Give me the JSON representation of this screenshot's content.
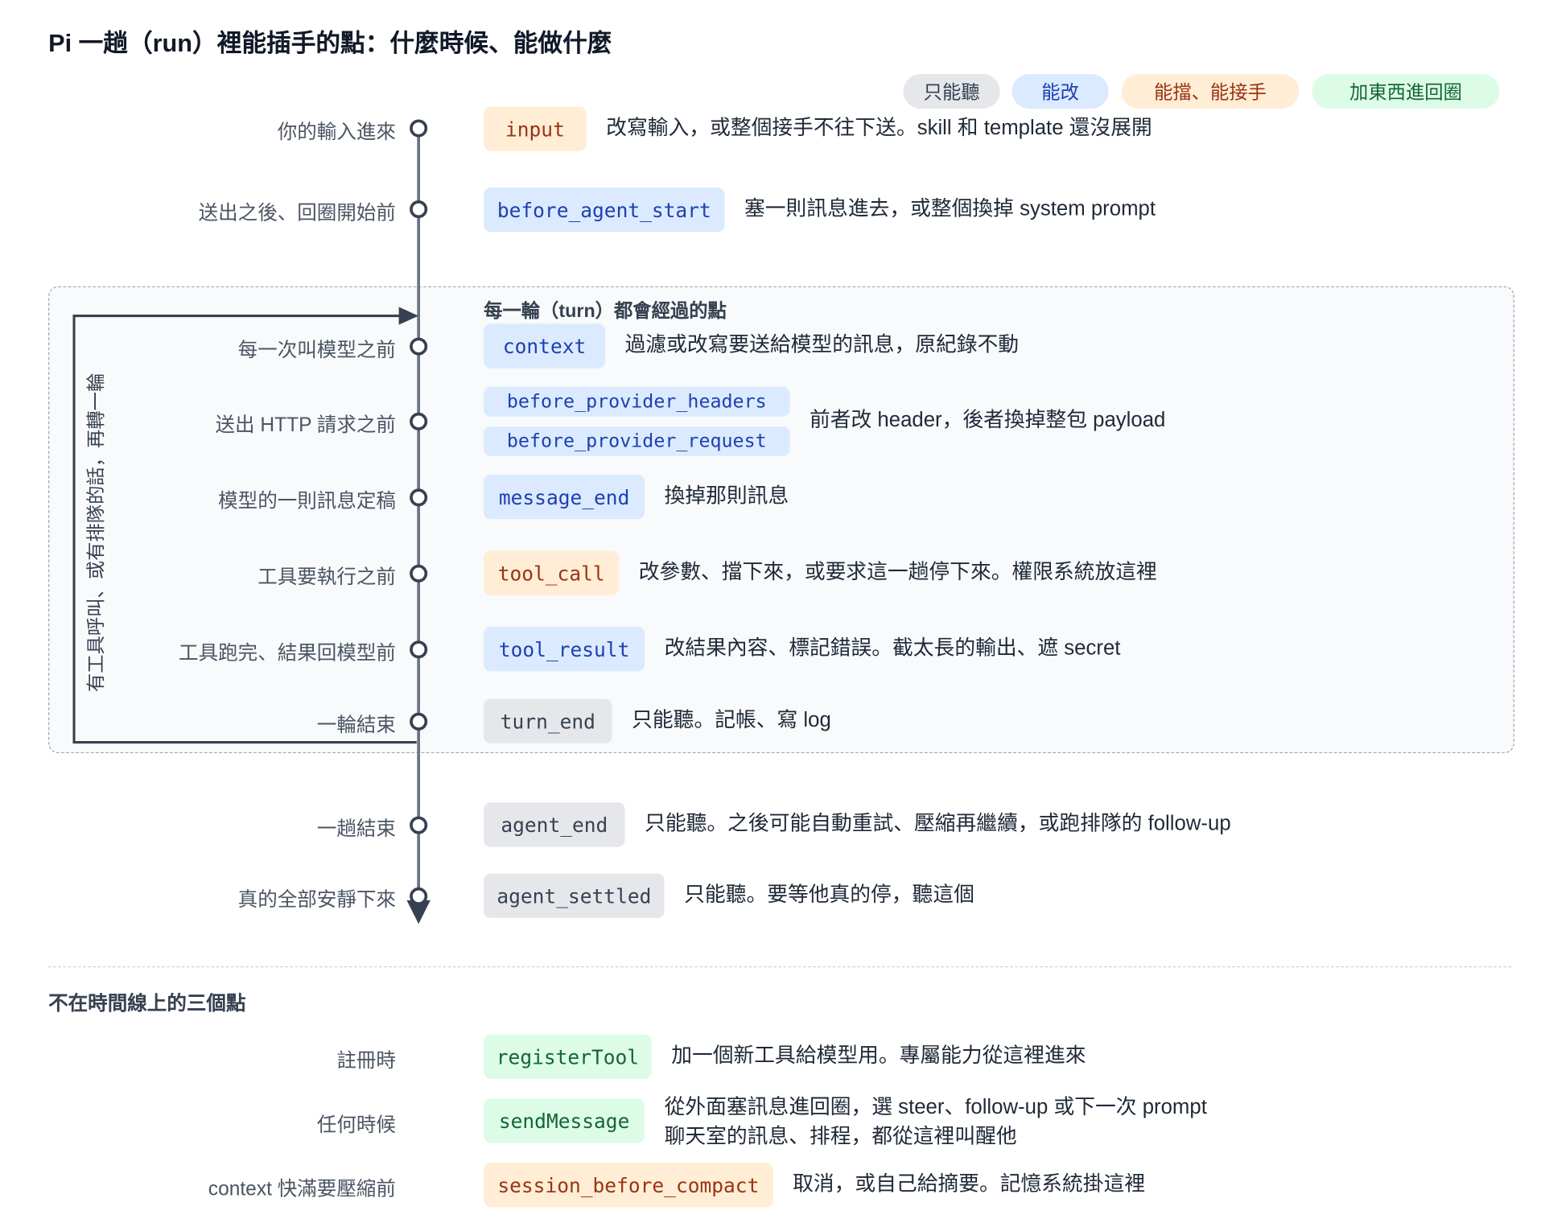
{
  "title": "Pi 一趟（run）裡能插手的點：什麼時候、能做什麼",
  "legend": {
    "listen": "只能聽",
    "modify": "能改",
    "block": "能擋、能接手",
    "add": "加東西進回圈"
  },
  "colors": {
    "listen_bg": "#e5e7eb",
    "modify_bg": "#dbeafe",
    "block_bg": "#ffedd5",
    "add_bg": "#dcfce7",
    "timeline": "#374151"
  },
  "timeline": {
    "input": {
      "label": "你的輸入進來",
      "hook": "input",
      "desc": "改寫輸入，或整個接手不往下送。skill 和 template 還沒展開"
    },
    "before_agent_start": {
      "label": "送出之後、回圈開始前",
      "hook": "before_agent_start",
      "desc": "塞一則訊息進去，或整個換掉 system prompt"
    },
    "context": {
      "label": "每一次叫模型之前",
      "hook": "context",
      "desc": "過濾或改寫要送給模型的訊息，原紀錄不動"
    },
    "provider": {
      "label": "送出 HTTP 請求之前",
      "hook1": "before_provider_headers",
      "hook2": "before_provider_request",
      "desc": "前者改 header，後者換掉整包 payload"
    },
    "message_end": {
      "label": "模型的一則訊息定稿",
      "hook": "message_end",
      "desc": "換掉那則訊息"
    },
    "tool_call": {
      "label": "工具要執行之前",
      "hook": "tool_call",
      "desc": "改參數、擋下來，或要求這一趟停下來。權限系統放這裡"
    },
    "tool_result": {
      "label": "工具跑完、結果回模型前",
      "hook": "tool_result",
      "desc": "改結果內容、標記錯誤。截太長的輸出、遮 secret"
    },
    "turn_end": {
      "label": "一輪結束",
      "hook": "turn_end",
      "desc": "只能聽。記帳、寫 log"
    },
    "agent_end": {
      "label": "一趟結束",
      "hook": "agent_end",
      "desc": "只能聽。之後可能自動重試、壓縮再繼續，或跑排隊的 follow-up"
    },
    "agent_settled": {
      "label": "真的全部安靜下來",
      "hook": "agent_settled",
      "desc": "只能聽。要等他真的停，聽這個"
    }
  },
  "turn_box": {
    "title": "每一輪（turn）都會經過的點",
    "loop_label": "有工具呼叫、或有排隊的話，再轉一輪"
  },
  "offline": {
    "title": "不在時間線上的三個點",
    "items": [
      {
        "label": "註冊時",
        "hook": "registerTool",
        "desc": "加一個新工具給模型用。專屬能力從這裡進來"
      },
      {
        "label": "任何時候",
        "hook": "sendMessage",
        "desc1": "從外面塞訊息進回圈，選 steer、follow-up 或下一次 prompt",
        "desc2": "聊天室的訊息、排程，都從這裡叫醒他"
      },
      {
        "label": "context 快滿要壓縮前",
        "hook": "session_before_compact",
        "desc": "取消，或自己給摘要。記憶系統掛這裡"
      }
    ]
  }
}
